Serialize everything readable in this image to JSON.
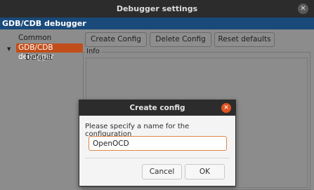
{
  "window": {
    "title": "Debugger settings",
    "close_glyph": "✕"
  },
  "header": {
    "title": "GDB/CDB debugger"
  },
  "tree": {
    "items": [
      {
        "label": "Common"
      },
      {
        "label": "GDB/CDB debugger",
        "selected": true
      },
      {
        "label": "Default"
      }
    ],
    "expand_glyph": "▼"
  },
  "toolbar": {
    "create_label": "Create Config",
    "delete_label": "Delete Config",
    "reset_label": "Reset defaults"
  },
  "info": {
    "label": "Info"
  },
  "dialog": {
    "title": "Create config",
    "close_glyph": "✕",
    "prompt": "Please specify a name for the configuration",
    "input_value": "OpenOCD",
    "cancel_label": "Cancel",
    "ok_label": "OK"
  },
  "colors": {
    "accent": "#e05423",
    "header_bar": "#1a4a7a",
    "selection": "#c14e1a"
  }
}
